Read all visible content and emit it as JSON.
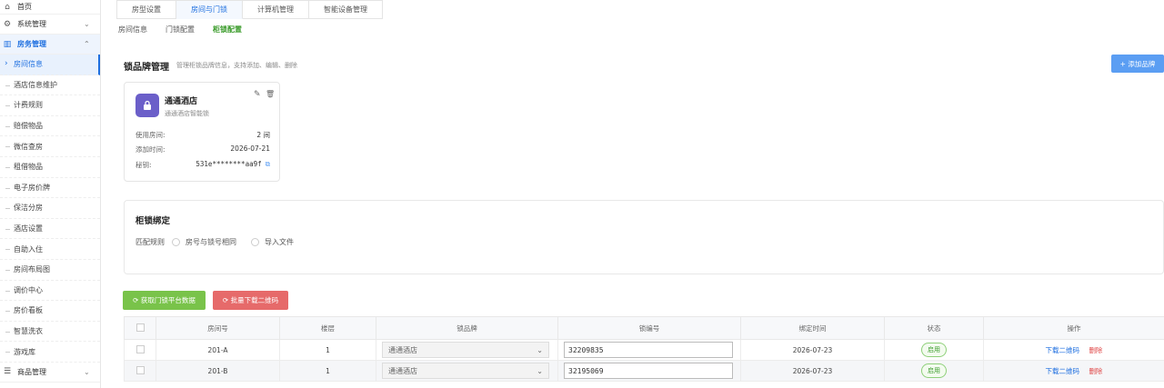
{
  "sidebar": {
    "home": "首页",
    "system": "系统管理",
    "room_mgmt": "房务管理",
    "sub_items": [
      "房间信息",
      "酒店信息维护",
      "计费规则",
      "赔偿物品",
      "微信查房",
      "租借物品",
      "电子房价牌",
      "保洁分房",
      "酒店设置",
      "自助入住",
      "房间布局图",
      "调价中心",
      "房价看板",
      "智慧洗衣",
      "游戏库"
    ],
    "goods": "商品管理"
  },
  "top_tabs": [
    "房型设置",
    "房间与门锁",
    "计算机管理",
    "智能设备管理"
  ],
  "sub_tabs": [
    "房间信息",
    "门锁配置",
    "柜锁配置"
  ],
  "brand_section": {
    "title": "锁品牌管理",
    "desc": "管理柜锁品牌信息，支持添加、编辑、删除",
    "add_button": "+ 添加品牌"
  },
  "brand_card": {
    "name": "通通酒店",
    "subtitle": "通通酒店智能锁",
    "rooms_label": "使用房间:",
    "rooms_value": "2 间",
    "added_label": "添加时间:",
    "added_value": "2026-07-21",
    "key_label": "秘钥:",
    "key_value": "531e********aa9f"
  },
  "binding": {
    "title": "柜锁绑定",
    "rule_label": "匹配规则",
    "option1": "房号与锁号相同",
    "option2": "导入文件"
  },
  "buttons": {
    "fetch": "⟳ 获取门锁平台数据",
    "batch_qr": "⟳ 批量下载二维码"
  },
  "table": {
    "headers": [
      "房间号",
      "楼层",
      "锁品牌",
      "锁编号",
      "绑定时间",
      "状态",
      "操作"
    ],
    "rows": [
      {
        "room": "201-A",
        "floor": "1",
        "brand": "通通酒店",
        "lock_no": "32209835",
        "bind_time": "2026-07-23",
        "status": "启用",
        "op_qr": "下载二维码",
        "op_del": "删除"
      },
      {
        "room": "201-B",
        "floor": "1",
        "brand": "通通酒店",
        "lock_no": "32195069",
        "bind_time": "2026-07-23",
        "status": "启用",
        "op_qr": "下载二维码",
        "op_del": "删除"
      }
    ]
  },
  "colors": {
    "primary": "#1e6fe0",
    "green": "#79c34a",
    "red": "#e66a6a",
    "lock_badge": "#6b5fc9"
  }
}
